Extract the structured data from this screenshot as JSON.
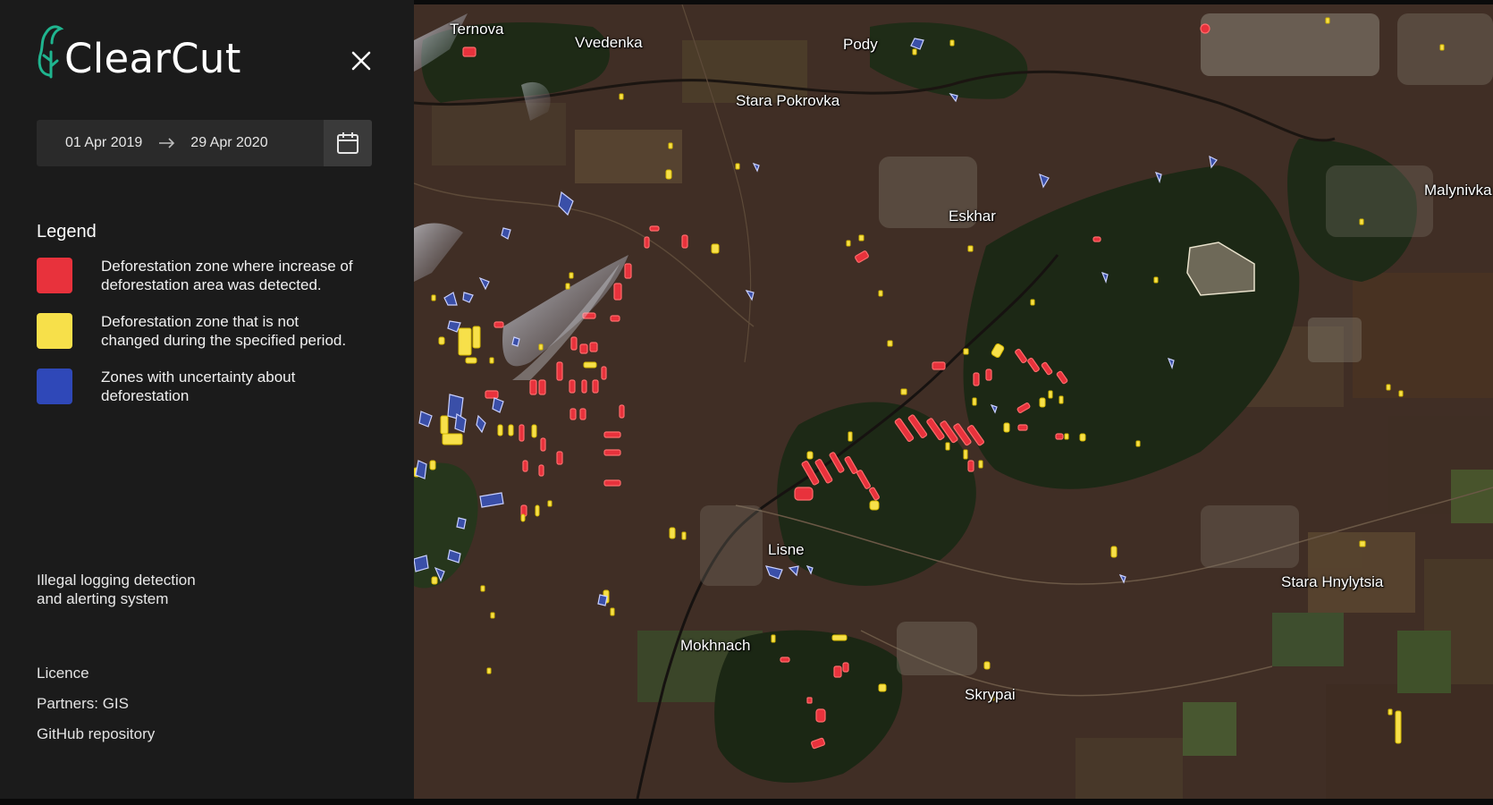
{
  "app": {
    "name": "ClearCut"
  },
  "date_range": {
    "start": "01 Apr 2019",
    "end": "29 Apr 2020"
  },
  "legend": {
    "title": "Legend",
    "items": [
      {
        "color": "#e8323c",
        "text": "Deforestation zone where increase of\ndeforestation area was detected."
      },
      {
        "color": "#f7e04a",
        "text": "Deforestation zone that is not\nchanged during the specified period."
      },
      {
        "color": "#2f48b8",
        "text": "Zones with uncertainty about\ndeforestation"
      }
    ]
  },
  "tagline": "Illegal logging detection\nand alerting system",
  "footer": {
    "licence": "Licence",
    "partners": "Partners: GIS",
    "github": "GitHub repository"
  },
  "map": {
    "places": [
      "Ternova",
      "Vvedenka",
      "Pody",
      "Stara Pokrovka",
      "Eskhar",
      "Malynivka",
      "Lisne",
      "Mokhnach",
      "Skrypai",
      "Stara Hnylytsia"
    ],
    "colors": {
      "red": "#e8323c",
      "yellow": "#f7e04a",
      "blue": "#3a4fa8",
      "outline_red": "#ff6b6b",
      "outline_yellow": "#d4b800",
      "outline_blue": "#c9d0ff"
    }
  }
}
